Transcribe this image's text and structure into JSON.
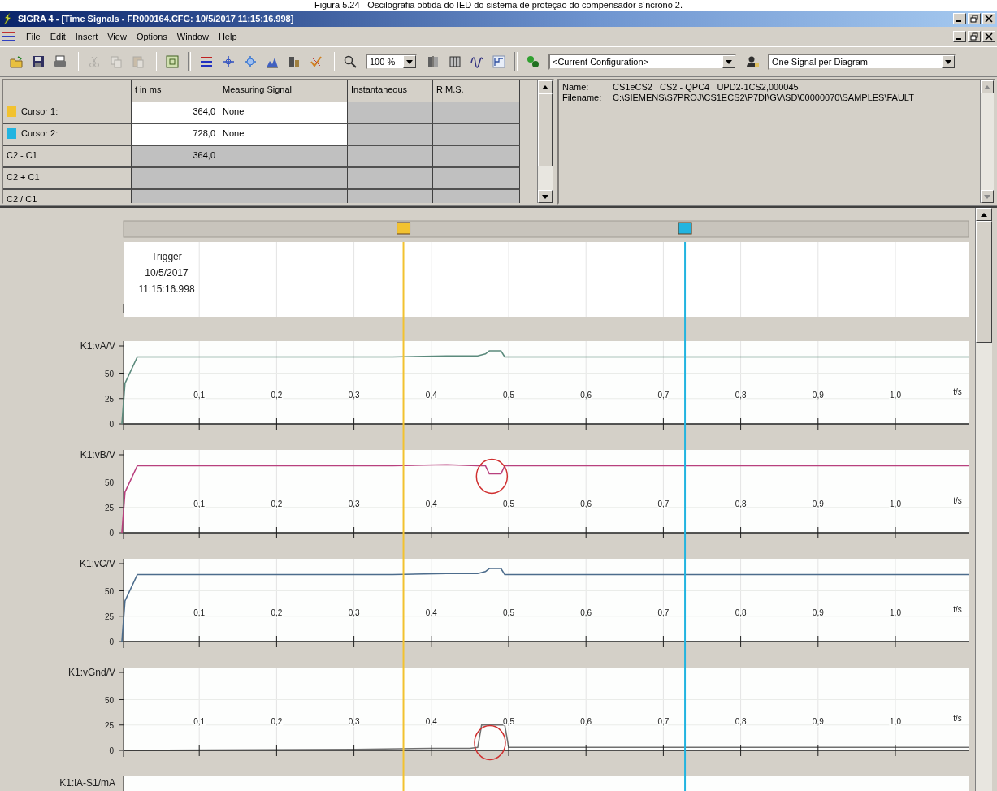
{
  "caption": "Figura 5.24 - Oscilografia obtida do IED do sistema de proteção do compensador síncrono 2.",
  "window": {
    "title": "SIGRA 4 - [Time Signals - FR000164.CFG: 10/5/2017 11:15:16.998]"
  },
  "menu": [
    "File",
    "Edit",
    "Insert",
    "View",
    "Options",
    "Window",
    "Help"
  ],
  "toolbar": [
    {
      "kind": "open",
      "disabled": false
    },
    {
      "kind": "save",
      "disabled": false
    },
    {
      "kind": "print",
      "disabled": false
    },
    {
      "kind": "separator"
    },
    {
      "kind": "cut",
      "disabled": true
    },
    {
      "kind": "copy",
      "disabled": true
    },
    {
      "kind": "paste",
      "disabled": true
    },
    {
      "kind": "separator"
    },
    {
      "kind": "frame",
      "disabled": false
    },
    {
      "kind": "separator"
    },
    {
      "kind": "lines",
      "disabled": false
    },
    {
      "kind": "cross",
      "disabled": false
    },
    {
      "kind": "cross2",
      "disabled": false
    },
    {
      "kind": "area",
      "disabled": false
    },
    {
      "kind": "bar",
      "disabled": false
    },
    {
      "kind": "check",
      "disabled": false
    },
    {
      "kind": "separator"
    },
    {
      "kind": "zoom",
      "disabled": false
    },
    {
      "kind": "combo",
      "value": "100 %"
    },
    {
      "kind": "split",
      "disabled": false
    },
    {
      "kind": "split2",
      "disabled": false
    },
    {
      "kind": "wave",
      "disabled": false
    },
    {
      "kind": "step",
      "disabled": false
    },
    {
      "kind": "separator"
    },
    {
      "kind": "link",
      "disabled": false
    },
    {
      "kind": "combo",
      "value": "<Current Configuration>"
    },
    {
      "kind": "person",
      "disabled": false
    },
    {
      "kind": "combo",
      "value": "One Signal per Diagram"
    }
  ],
  "cursor_table": {
    "columns": [
      "t in ms",
      "Measuring Signal",
      "Instantaneous",
      "R.M.S."
    ],
    "rows": [
      {
        "label": "Cursor 1:",
        "color": "#f2c230",
        "t": "364,0",
        "signal": "None",
        "editable": true
      },
      {
        "label": "Cursor 2:",
        "color": "#22b4e0",
        "t": "728,0",
        "signal": "None",
        "editable": true
      },
      {
        "label": "C2 - C1",
        "t": "364,0",
        "editable": false
      },
      {
        "label": "C2 + C1",
        "editable": false
      },
      {
        "label": "C2 / C1",
        "editable": false
      }
    ]
  },
  "info": {
    "name_label": "Name:",
    "name": "CS1eCS2   CS2 - QPC4   UPD2-1CS2,000045",
    "filename_label": "Filename:",
    "filename": "C:\\SIEMENS\\S7PROJ\\CS1ECS2\\P7DI\\GV\\SD\\00000070\\SAMPLES\\FAULT"
  },
  "trigger": {
    "lines": [
      "Trigger",
      "10/5/2017",
      "11:15:16.998"
    ]
  },
  "diagrams": [
    {
      "highlighted": false,
      "chart_data": {
        "type": "line",
        "xlabel": "t/s",
        "xlim": [
          0,
          1.095
        ],
        "ylim": [
          0,
          80
        ],
        "yticks": [
          0,
          25,
          50
        ],
        "grid": true,
        "xticks": [
          {
            "value": 0.1,
            "label": "0,1"
          },
          {
            "value": 0.2,
            "label": "0,2"
          },
          {
            "value": 0.3,
            "label": "0,3"
          },
          {
            "value": 0.4,
            "label": "0,4"
          },
          {
            "value": 0.5,
            "label": "0,5"
          },
          {
            "value": 0.6,
            "label": "0,6"
          },
          {
            "value": 0.7,
            "label": "0,7"
          },
          {
            "value": 0.8,
            "label": "0,8"
          },
          {
            "value": 0.9,
            "label": "0,9"
          },
          {
            "value": 1.0,
            "label": "1,0"
          }
        ],
        "x": [
          0,
          0.004,
          0.02,
          0.35,
          0.42,
          0.46,
          0.47,
          0.475,
          0.49,
          0.495,
          1.095
        ],
        "series": [
          {
            "name": "K1:vA/V",
            "color": "#5b8a7c",
            "values": [
              0,
              40,
              66,
              66,
              67,
              67,
              69,
              72,
              72,
              66,
              66
            ]
          }
        ],
        "ref_lines": [
          {
            "axis": "x",
            "value": 0.364,
            "color": "#f2c230"
          },
          {
            "axis": "x",
            "value": 0.728,
            "color": "#22b4e0"
          }
        ]
      }
    },
    {
      "highlighted": true,
      "chart_data": {
        "type": "line",
        "xlabel": "t/s",
        "xlim": [
          0,
          1.095
        ],
        "ylim": [
          0,
          80
        ],
        "yticks": [
          0,
          25,
          50
        ],
        "grid": true,
        "xticks": [
          {
            "value": 0.1,
            "label": "0,1"
          },
          {
            "value": 0.2,
            "label": "0,2"
          },
          {
            "value": 0.3,
            "label": "0,3"
          },
          {
            "value": 0.4,
            "label": "0,4"
          },
          {
            "value": 0.5,
            "label": "0,5"
          },
          {
            "value": 0.6,
            "label": "0,6"
          },
          {
            "value": 0.7,
            "label": "0,7"
          },
          {
            "value": 0.8,
            "label": "0,8"
          },
          {
            "value": 0.9,
            "label": "0,9"
          },
          {
            "value": 1.0,
            "label": "1,0"
          }
        ],
        "x": [
          0,
          0.004,
          0.02,
          0.35,
          0.42,
          0.46,
          0.47,
          0.475,
          0.49,
          0.495,
          1.095
        ],
        "series": [
          {
            "name": "K1:vB/V",
            "color": "#b8407e",
            "values": [
              0,
              40,
              66,
              66,
              67,
              66,
              66,
              58,
              58,
              66,
              66
            ]
          }
        ],
        "ref_lines": [
          {
            "axis": "x",
            "value": 0.364,
            "color": "#f2c230"
          },
          {
            "axis": "x",
            "value": 0.728,
            "color": "#22b4e0"
          }
        ]
      }
    },
    {
      "highlighted": false,
      "chart_data": {
        "type": "line",
        "xlabel": "t/s",
        "xlim": [
          0,
          1.095
        ],
        "ylim": [
          0,
          80
        ],
        "yticks": [
          0,
          25,
          50
        ],
        "grid": true,
        "xticks": [
          {
            "value": 0.1,
            "label": "0,1"
          },
          {
            "value": 0.2,
            "label": "0,2"
          },
          {
            "value": 0.3,
            "label": "0,3"
          },
          {
            "value": 0.4,
            "label": "0,4"
          },
          {
            "value": 0.5,
            "label": "0,5"
          },
          {
            "value": 0.6,
            "label": "0,6"
          },
          {
            "value": 0.7,
            "label": "0,7"
          },
          {
            "value": 0.8,
            "label": "0,8"
          },
          {
            "value": 0.9,
            "label": "0,9"
          },
          {
            "value": 1.0,
            "label": "1,0"
          }
        ],
        "x": [
          0,
          0.004,
          0.02,
          0.35,
          0.42,
          0.46,
          0.47,
          0.475,
          0.49,
          0.495,
          1.095
        ],
        "series": [
          {
            "name": "K1:vC/V",
            "color": "#4c6c8c",
            "values": [
              0,
              40,
              66,
              66,
              67,
              67,
              69,
              72,
              72,
              66,
              66
            ]
          }
        ],
        "ref_lines": [
          {
            "axis": "x",
            "value": 0.364,
            "color": "#f2c230"
          },
          {
            "axis": "x",
            "value": 0.728,
            "color": "#22b4e0"
          }
        ]
      }
    },
    {
      "highlighted": true,
      "chart_data": {
        "type": "line",
        "xlabel": "t/s",
        "xlim": [
          0,
          1.095
        ],
        "ylim": [
          0,
          80
        ],
        "yticks": [
          0,
          25,
          50
        ],
        "grid": true,
        "xticks": [
          {
            "value": 0.1,
            "label": "0,1"
          },
          {
            "value": 0.2,
            "label": "0,2"
          },
          {
            "value": 0.3,
            "label": "0,3"
          },
          {
            "value": 0.4,
            "label": "0,4"
          },
          {
            "value": 0.5,
            "label": "0,5"
          },
          {
            "value": 0.6,
            "label": "0,6"
          },
          {
            "value": 0.7,
            "label": "0,7"
          },
          {
            "value": 0.8,
            "label": "0,8"
          },
          {
            "value": 0.9,
            "label": "0,9"
          },
          {
            "value": 1.0,
            "label": "1,0"
          }
        ],
        "x": [
          0,
          0.3,
          0.4,
          0.45,
          0.46,
          0.465,
          0.495,
          0.5,
          1.095
        ],
        "series": [
          {
            "name": "K1:vGnd/V",
            "color": "#707070",
            "values": [
              0,
              1,
              2,
              2,
              3,
              25,
              25,
              3,
              3
            ]
          }
        ],
        "ref_lines": [
          {
            "axis": "x",
            "value": 0.364,
            "color": "#f2c230"
          },
          {
            "axis": "x",
            "value": 0.728,
            "color": "#22b4e0"
          }
        ]
      }
    }
  ],
  "partial_diagram": {
    "label": "K1:iA-S1/mA"
  }
}
